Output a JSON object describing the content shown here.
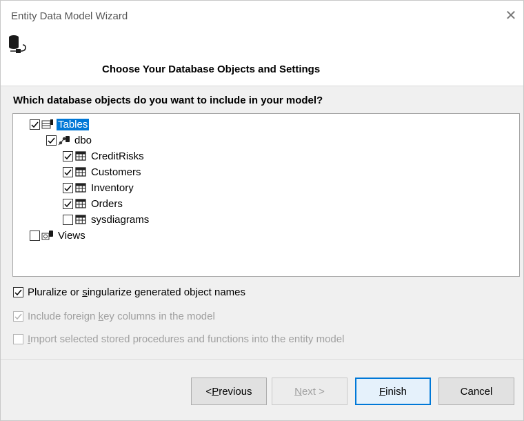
{
  "window": {
    "title": "Entity Data Model Wizard",
    "close_glyph": "✕"
  },
  "page": {
    "heading": "Choose Your Database Objects and Settings",
    "question": "Which database objects do you want to include in your model?"
  },
  "tree": {
    "tables": {
      "label": "Tables",
      "checked": true,
      "selected": true,
      "icon": "tables-icon"
    },
    "schema": {
      "label": "dbo",
      "checked": true,
      "icon": "schema-icon"
    },
    "items": [
      {
        "label": "CreditRisks",
        "checked": true,
        "icon": "table-icon"
      },
      {
        "label": "Customers",
        "checked": true,
        "icon": "table-icon"
      },
      {
        "label": "Inventory",
        "checked": true,
        "icon": "table-icon"
      },
      {
        "label": "Orders",
        "checked": true,
        "icon": "table-icon"
      },
      {
        "label": "sysdiagrams",
        "checked": false,
        "icon": "table-icon"
      }
    ],
    "views": {
      "label": "Views",
      "checked": false,
      "icon": "views-icon"
    }
  },
  "options": {
    "pluralize": {
      "prefix": "Pluralize or ",
      "accel": "s",
      "suffix": "ingularize generated object names",
      "checked": true,
      "enabled": true
    },
    "foreign_keys": {
      "prefix": "Include foreign ",
      "accel": "k",
      "suffix": "ey columns in the model",
      "checked": true,
      "enabled": false
    },
    "stored_procs": {
      "prefix": "",
      "accel": "I",
      "suffix": "mport selected stored procedures and functions into the entity model",
      "checked": false,
      "enabled": false
    }
  },
  "buttons": {
    "previous": {
      "prefix": "< ",
      "accel": "P",
      "suffix": "revious"
    },
    "next": {
      "prefix": "",
      "accel": "N",
      "suffix": "ext >"
    },
    "finish": {
      "prefix": "",
      "accel": "F",
      "suffix": "inish"
    },
    "cancel": {
      "label": "Cancel"
    }
  },
  "colors": {
    "selection": "#0078d7",
    "disabled_text": "#a0a0a0"
  }
}
